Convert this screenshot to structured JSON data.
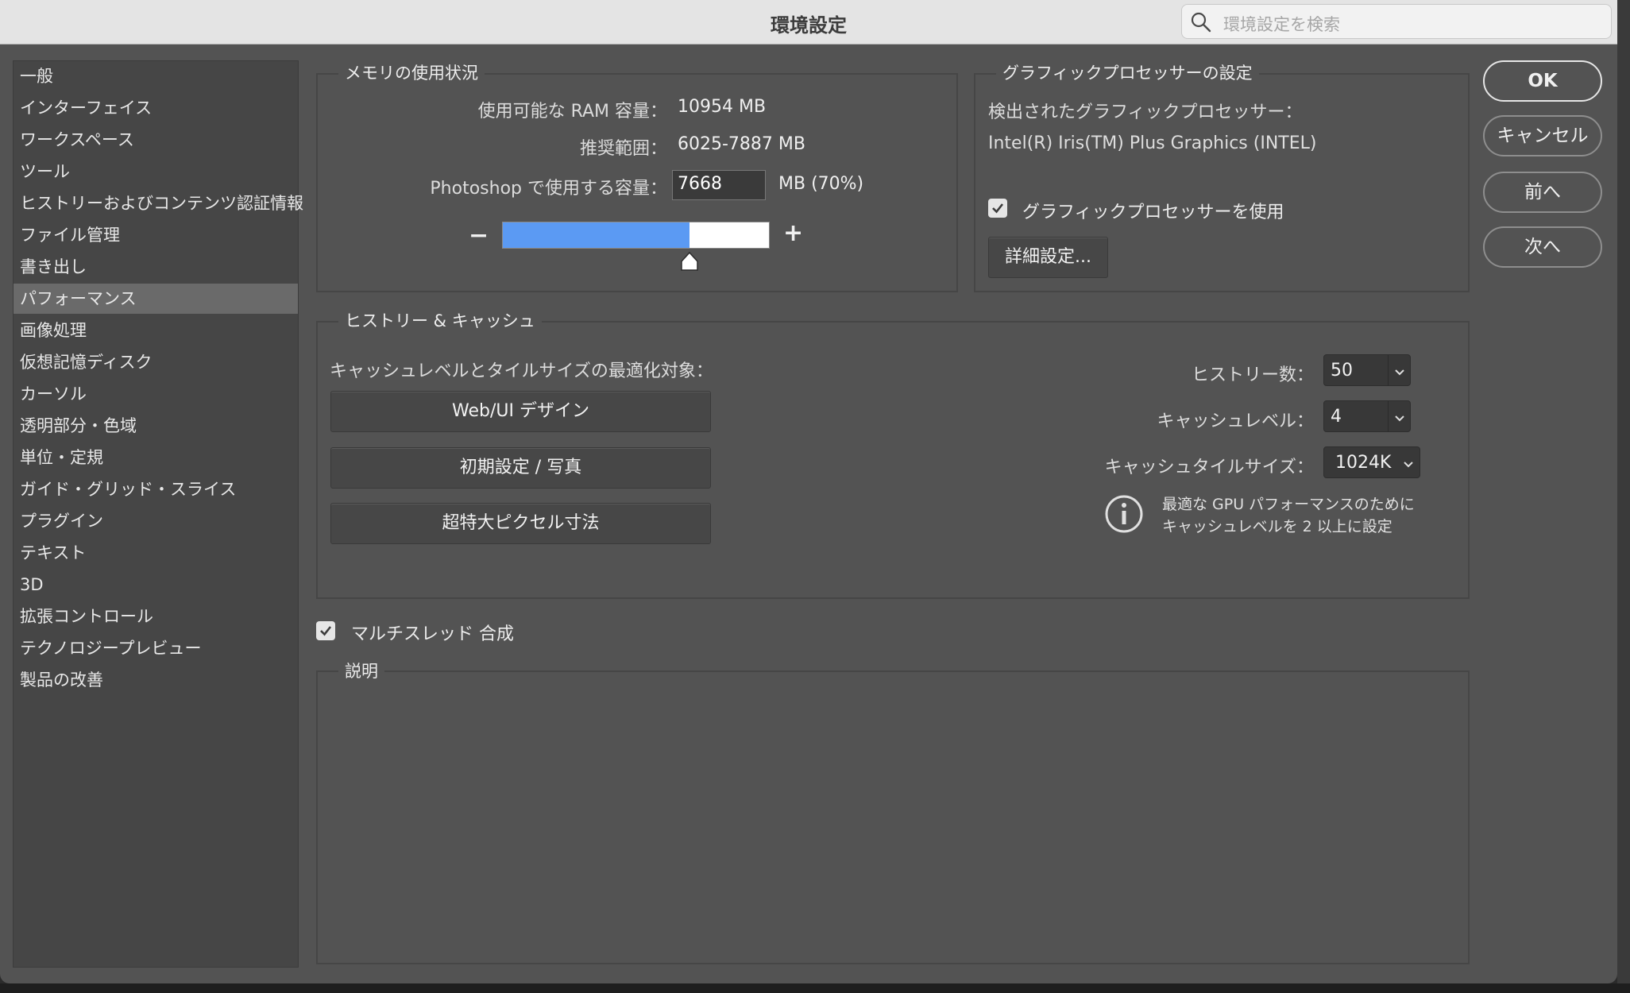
{
  "window": {
    "title": "環境設定",
    "search_placeholder": "環境設定を検索"
  },
  "sidebar": {
    "selected_index": 7,
    "items": [
      {
        "label": "一般"
      },
      {
        "label": "インターフェイス"
      },
      {
        "label": "ワークスペース"
      },
      {
        "label": "ツール"
      },
      {
        "label": "ヒストリーおよびコンテンツ認証情報"
      },
      {
        "label": "ファイル管理"
      },
      {
        "label": "書き出し"
      },
      {
        "label": "パフォーマンス"
      },
      {
        "label": "画像処理"
      },
      {
        "label": "仮想記憶ディスク"
      },
      {
        "label": "カーソル"
      },
      {
        "label": "透明部分・色域"
      },
      {
        "label": "単位・定規"
      },
      {
        "label": "ガイド・グリッド・スライス"
      },
      {
        "label": "プラグイン"
      },
      {
        "label": "テキスト"
      },
      {
        "label": "3D"
      },
      {
        "label": "拡張コントロール"
      },
      {
        "label": "テクノロジープレビュー"
      },
      {
        "label": "製品の改善"
      }
    ]
  },
  "memory": {
    "group_title": "メモリの使用状況",
    "ram_label": "使用可能な RAM 容量：",
    "ram_value": "10954 MB",
    "range_label": "推奨範囲：",
    "range_value": "6025-7887 MB",
    "use_label": "Photoshop で使用する容量：",
    "use_value": "7668",
    "use_suffix": "MB (70%)",
    "minus": "−",
    "plus": "+",
    "slider_fraction": 0.7
  },
  "gpu": {
    "group_title": "グラフィックプロセッサーの設定",
    "detected_label": "検出されたグラフィックプロセッサー：",
    "detected_value": "Intel(R) Iris(TM) Plus Graphics (INTEL)",
    "use_gpu_label": "グラフィックプロセッサーを使用",
    "use_gpu_checked": true,
    "advanced_button": "詳細設定..."
  },
  "history_cache": {
    "group_title": "ヒストリー & キャッシュ",
    "optimize_label": "キャッシュレベルとタイルサイズの最適化対象：",
    "preset_buttons": [
      {
        "label": "Web/UI デザイン"
      },
      {
        "label": "初期設定 / 写真"
      },
      {
        "label": "超特大ピクセル寸法"
      }
    ],
    "history_label": "ヒストリー数：",
    "history_value": "50",
    "cache_level_label": "キャッシュレベル：",
    "cache_level_value": "4",
    "tile_size_label": "キャッシュタイルサイズ：",
    "tile_size_value": "1024K",
    "info_line1": "最適な GPU パフォーマンスのために",
    "info_line2": "キャッシュレベルを 2 以上に設定"
  },
  "multithread": {
    "label": "マルチスレッド 合成",
    "checked": true
  },
  "description": {
    "group_title": "説明"
  },
  "actions": {
    "ok": "OK",
    "cancel": "キャンセル",
    "prev": "前へ",
    "next": "次へ"
  },
  "colors": {
    "dialog_bg": "#535353",
    "sidebar_bg": "#464646",
    "selected_bg": "#6a6a6a",
    "slider_fill": "#5b9af3"
  }
}
